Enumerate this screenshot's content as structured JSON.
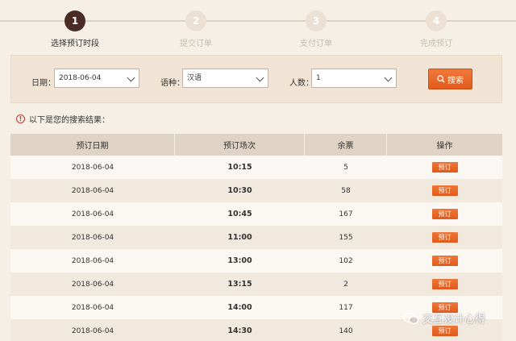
{
  "steps": [
    {
      "number": "1",
      "label": "选择预订时段",
      "active": true
    },
    {
      "number": "2",
      "label": "提交订单",
      "active": false
    },
    {
      "number": "3",
      "label": "支付订单",
      "active": false
    },
    {
      "number": "4",
      "label": "完成预订",
      "active": false
    }
  ],
  "search": {
    "date_label": "日期：",
    "date_value": "2018-06-04",
    "language_label": "语种：",
    "language_value": "汉语",
    "people_label": "人数：",
    "people_value": "1",
    "search_button": "搜索"
  },
  "result_text": "以下是您的搜索结果：",
  "table": {
    "headers": [
      "预订日期",
      "预订场次",
      "余票",
      "操作"
    ],
    "book_label": "预订",
    "rows": [
      {
        "date": "2018-06-04",
        "time": "10:15",
        "remaining": "5"
      },
      {
        "date": "2018-06-04",
        "time": "10:30",
        "remaining": "58"
      },
      {
        "date": "2018-06-04",
        "time": "10:45",
        "remaining": "167"
      },
      {
        "date": "2018-06-04",
        "time": "11:00",
        "remaining": "155"
      },
      {
        "date": "2018-06-04",
        "time": "13:00",
        "remaining": "102"
      },
      {
        "date": "2018-06-04",
        "time": "13:15",
        "remaining": "2"
      },
      {
        "date": "2018-06-04",
        "time": "14:00",
        "remaining": "117"
      },
      {
        "date": "2018-06-04",
        "time": "14:30",
        "remaining": "140"
      }
    ]
  },
  "watermark": "交互设计心得",
  "colors": {
    "accent": "#e8642a",
    "active_step": "#4a2b26",
    "header_bg": "#dfd3c5"
  }
}
